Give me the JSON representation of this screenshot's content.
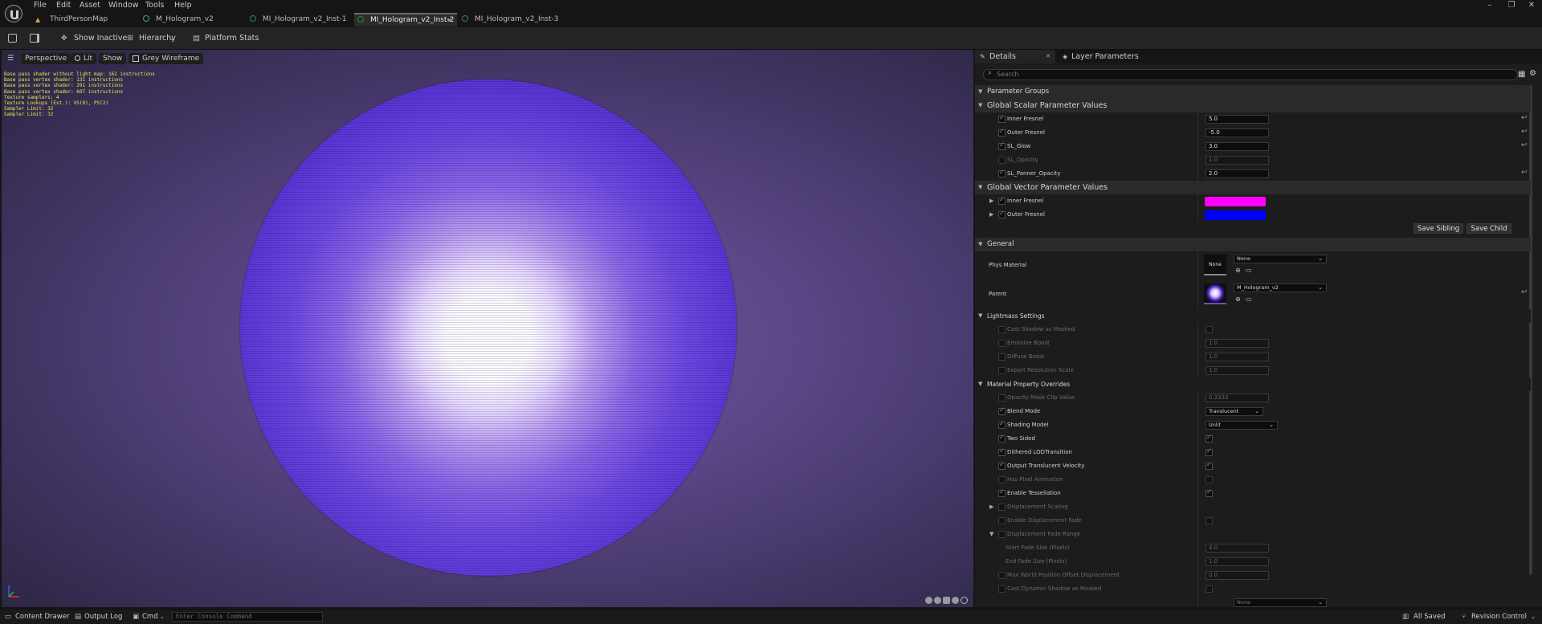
{
  "menu": [
    "File",
    "Edit",
    "Asset",
    "Window",
    "Tools",
    "Help"
  ],
  "tabs": [
    {
      "label": "ThirdPersonMap"
    },
    {
      "label": "M_Hologram_v2"
    },
    {
      "label": "MI_Hologram_v2_Inst-1"
    },
    {
      "label": "MI_Hologram_v2_Inst-2"
    },
    {
      "label": "MI_Hologram_v2_Inst-3"
    }
  ],
  "toolbar": {
    "show_inactive": "Show Inactive",
    "hierarchy": "Hierarchy",
    "platform_stats": "Platform Stats"
  },
  "viewport": {
    "buttons": [
      "Perspective",
      "Lit",
      "Show",
      "Grey Wireframe"
    ],
    "stats": "Base pass shader without light map: 162 instructions\nBase pass vertex shader: 131 instructions\nBase pass vertex shader: 291 instructions\nBase pass vertex shader: 607 instructions\nTexture samplers: 4\nTexture Lookups (Est.): VS(0), PS(2)\nSampler Limit: 32\nSampler Limit: 32"
  },
  "panel": {
    "tab_details": "Details",
    "tab_layers": "Layer Parameters",
    "search_placeholder": "Search",
    "parameter_groups": "Parameter Groups",
    "global_scalar": "Global Scalar Parameter Values",
    "scalar": [
      {
        "name": "Inner Fresnel",
        "value": "5.0"
      },
      {
        "name": "Outer Fresnel",
        "value": "-5.0"
      },
      {
        "name": "SL_Glow",
        "value": "3.0"
      },
      {
        "name": "SL_Opacity",
        "value": "1.0"
      },
      {
        "name": "SL_Panner_Opacity",
        "value": "2.0"
      }
    ],
    "global_vector": "Global Vector Parameter Values",
    "vector": [
      {
        "name": "Inner Fresnel",
        "color": "#ff00ff"
      },
      {
        "name": "Outer Fresnel",
        "color": "#0000ff"
      }
    ],
    "save_sibling": "Save Sibling",
    "save_child": "Save Child",
    "general": "General",
    "phys_material_label": "Phys Material",
    "phys_material_thumb": "None",
    "phys_material_value": "None",
    "parent_label": "Parent",
    "parent_value": "M_Hologram_v2",
    "lightmass": "Lightmass Settings",
    "lightmass_rows": [
      {
        "name": "Cast Shadow as Masked",
        "value": ""
      },
      {
        "name": "Emissive Boost",
        "value": "1.0"
      },
      {
        "name": "Diffuse Boost",
        "value": "1.0"
      },
      {
        "name": "Export Resolution Scale",
        "value": "1.0"
      }
    ],
    "overrides": "Material Property Overrides",
    "override_rows": [
      {
        "name": "Opacity Mask Clip Value",
        "value": "0.3333"
      },
      {
        "name": "Blend Mode",
        "value": "Translucent"
      },
      {
        "name": "Shading Model",
        "value": "Unlit"
      },
      {
        "name": "Two Sided",
        "value": ""
      },
      {
        "name": "Dithered LODTransition",
        "value": ""
      },
      {
        "name": "Output Translucent Velocity",
        "value": ""
      },
      {
        "name": "Has Pixel Animation",
        "value": ""
      },
      {
        "name": "Enable Tessellation",
        "value": ""
      },
      {
        "name": "Displacement Scaling",
        "value": ""
      },
      {
        "name": "Enable Displacement Fade",
        "value": ""
      },
      {
        "name": "Displacement Fade Range",
        "value": ""
      },
      {
        "name": "Start Fade Size (Pixels)",
        "value": "4.0"
      },
      {
        "name": "End Fade Size (Pixels)",
        "value": "1.0"
      },
      {
        "name": "Max World Position Offset Displacement",
        "value": "0.0"
      },
      {
        "name": "Cast Dynamic Shadow as Masked",
        "value": ""
      },
      {
        "name": "",
        "value": "None"
      }
    ]
  },
  "status": {
    "content_drawer": "Content Drawer",
    "output_log": "Output Log",
    "cmd": "Cmd",
    "console_placeholder": "Enter Console Command",
    "all_saved": "All Saved",
    "revision_control": "Revision Control"
  }
}
